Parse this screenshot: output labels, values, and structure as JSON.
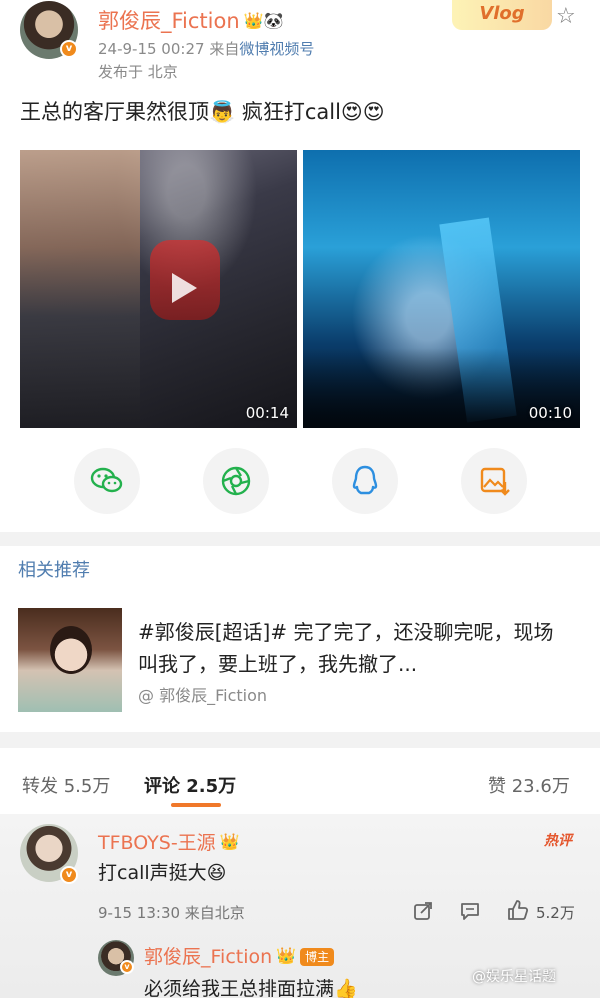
{
  "post": {
    "author": "郭俊辰_Fiction",
    "author_emojis": "👑🐼",
    "timestamp": "24-9-15 00:27",
    "source_prefix": "来自",
    "source_name": "微博视频号",
    "location": "发布于 北京",
    "tag": "Vlog",
    "text": "王总的客厅果然很顶👼 疯狂打call😍😍",
    "videos": [
      {
        "duration": "00:14"
      },
      {
        "duration": "00:10"
      }
    ]
  },
  "share_icons": [
    "wechat-icon",
    "moments-icon",
    "qq-icon",
    "save-image-icon"
  ],
  "related": {
    "header": "相关推荐",
    "title": "#郭俊辰[超话]# 完了完了，还没聊完呢，现场叫我了，要上班了，我先撤了...",
    "author": "@ 郭俊辰_Fiction"
  },
  "tabs": {
    "repost_label": "转发",
    "repost_count": "5.5万",
    "comment_label": "评论",
    "comment_count": "2.5万",
    "like_label": "赞",
    "like_count": "23.6万"
  },
  "comment": {
    "author": "TFBOYS-王源",
    "author_emoji": "👑",
    "hot_badge": "热评",
    "text": "打call声挺大😆",
    "time_loc": "9-15 13:30 来自北京",
    "likes": "5.2万",
    "reply": {
      "author": "郭俊辰_Fiction",
      "author_emoji": "👑",
      "badge": "博主",
      "text": "必须给我王总排面拉满👍"
    }
  },
  "watermark": "@娱乐星话题",
  "colors": {
    "username": "#eb7350",
    "link": "#507daf",
    "accent": "#f0782a"
  }
}
